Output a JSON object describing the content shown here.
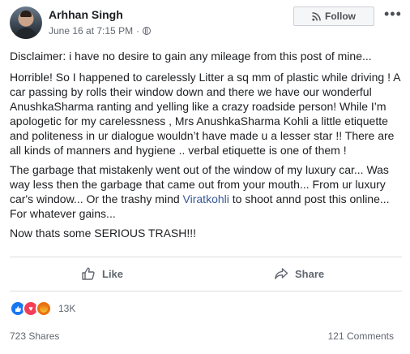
{
  "post": {
    "author": "Arhhan Singh",
    "timestamp": "June 16 at 7:15 PM",
    "separator": "·",
    "privacy_icon": "globe-icon"
  },
  "header": {
    "follow_label": "Follow",
    "follow_icon": "rss-icon",
    "more_icon": "ellipsis-icon"
  },
  "body": {
    "p1": "Disclaimer: i have no desire to gain any mileage from this post of mine...",
    "p2": "Horrible! So I happened to carelessly Litter a sq mm of plastic while driving ! A car passing by rolls their window down and there we have our wonderful AnushkaSharma ranting and yelling like a crazy roadside person! While I’m apologetic for my carelessness , Mrs AnushkaSharma Kohli a little etiquette and politeness in ur dialogue wouldn’t have made u a lesser star !! There are all kinds of manners and hygiene .. verbal etiquette is one of them !",
    "p3_before": "The garbage that mistakenly went out of the window of my luxury car... Was way less then the garbage that came out from your mouth... From ur luxury car's window... Or the trashy mind ",
    "p3_link": "Viratkohli",
    "p3_after": " to shoot annd post this online... For whatever gains...",
    "p4": "Now thats some SERIOUS TRASH!!!"
  },
  "actions": {
    "like_label": "Like",
    "share_label": "Share"
  },
  "stats": {
    "reactions": [
      "like",
      "love",
      "angry"
    ],
    "reaction_count": "13K",
    "shares": "723 Shares",
    "comments": "121 Comments"
  },
  "colors": {
    "link": "#385898",
    "like_reaction": "#1877f2",
    "love_reaction": "#f33e58",
    "muted_text": "#606770"
  }
}
